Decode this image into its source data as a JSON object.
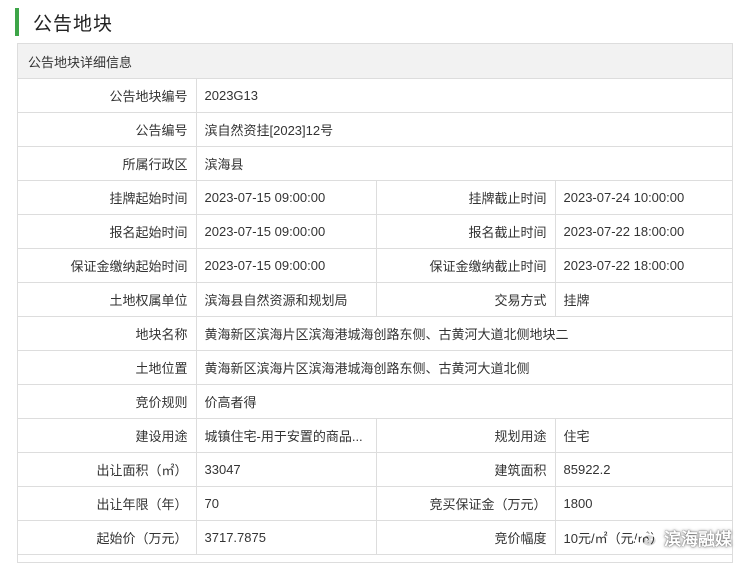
{
  "header": {
    "title": "公告地块"
  },
  "panel": {
    "title": "公告地块详细信息"
  },
  "rows": [
    {
      "label": "公告地块编号",
      "value": "2023G13"
    },
    {
      "label": "公告编号",
      "value": "滨自然资挂[2023]12号"
    },
    {
      "label": "所属行政区",
      "value": "滨海县"
    },
    {
      "label": "挂牌起始时间",
      "value": "2023-07-15 09:00:00",
      "label2": "挂牌截止时间",
      "value2": "2023-07-24 10:00:00"
    },
    {
      "label": "报名起始时间",
      "value": "2023-07-15 09:00:00",
      "label2": "报名截止时间",
      "value2": "2023-07-22 18:00:00"
    },
    {
      "label": "保证金缴纳起始时间",
      "value": "2023-07-15 09:00:00",
      "label2": "保证金缴纳截止时间",
      "value2": "2023-07-22 18:00:00"
    },
    {
      "label": "土地权属单位",
      "value": "滨海县自然资源和规划局",
      "label2": "交易方式",
      "value2": "挂牌"
    },
    {
      "label": "地块名称",
      "value": "黄海新区滨海片区滨海港城海创路东侧、古黄河大道北侧地块二"
    },
    {
      "label": "土地位置",
      "value": "黄海新区滨海片区滨海港城海创路东侧、古黄河大道北侧"
    },
    {
      "label": "竞价规则",
      "value": "价高者得"
    },
    {
      "label": "建设用途",
      "value": "城镇住宅-用于安置的商品...",
      "label2": "规划用途",
      "value2": "住宅"
    },
    {
      "label": "出让面积（㎡）",
      "value": "33047",
      "label2": "建筑面积",
      "value2": "85922.2"
    },
    {
      "label": "出让年限（年）",
      "value": "70",
      "label2": "竞买保证金（万元）",
      "value2": "1800"
    },
    {
      "label": "起始价（万元）",
      "value": "3717.7875",
      "label2": "竞价幅度",
      "value2": "10元/㎡（元/㎡）"
    }
  ],
  "watermark": {
    "text": "滨海融媒",
    "icon": "wechat-icon"
  },
  "colors": {
    "accent": "#3da548",
    "border": "#dddddd",
    "header_bg": "#f2f2f2"
  }
}
